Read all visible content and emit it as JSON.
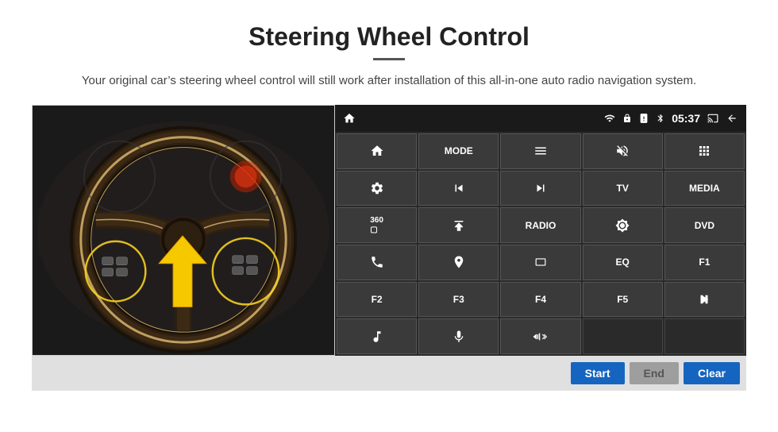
{
  "page": {
    "title": "Steering Wheel Control",
    "subtitle": "Your original car’s steering wheel control will still work after installation of this all-in-one auto radio navigation system.",
    "divider": true
  },
  "status_bar": {
    "time": "05:37",
    "icons": [
      "wifi",
      "lock",
      "sim",
      "bluetooth",
      "battery",
      "cast",
      "back"
    ]
  },
  "button_rows": [
    [
      {
        "label": "⌂",
        "type": "icon",
        "id": "home"
      },
      {
        "label": "MODE",
        "type": "text",
        "id": "mode"
      },
      {
        "label": "≡",
        "type": "icon",
        "id": "menu"
      },
      {
        "label": "🔇",
        "type": "icon",
        "id": "mute"
      },
      {
        "label": "⋯⋯",
        "type": "icon",
        "id": "apps"
      }
    ],
    [
      {
        "label": "⚙",
        "type": "icon",
        "id": "settings"
      },
      {
        "label": "⏮",
        "type": "icon",
        "id": "prev"
      },
      {
        "label": "⏭",
        "type": "icon",
        "id": "next"
      },
      {
        "label": "TV",
        "type": "text",
        "id": "tv"
      },
      {
        "label": "MEDIA",
        "type": "text",
        "id": "media"
      }
    ],
    [
      {
        "label": "360□",
        "type": "icon",
        "id": "camera360"
      },
      {
        "label": "⏶",
        "type": "icon",
        "id": "eject"
      },
      {
        "label": "RADIO",
        "type": "text",
        "id": "radio"
      },
      {
        "label": "☀",
        "type": "icon",
        "id": "brightness"
      },
      {
        "label": "DVD",
        "type": "text",
        "id": "dvd"
      }
    ],
    [
      {
        "label": "☎",
        "type": "icon",
        "id": "phone"
      },
      {
        "label": "⌘",
        "type": "icon",
        "id": "nav"
      },
      {
        "label": "▬",
        "type": "icon",
        "id": "screen"
      },
      {
        "label": "EQ",
        "type": "text",
        "id": "eq"
      },
      {
        "label": "F1",
        "type": "text",
        "id": "f1"
      }
    ],
    [
      {
        "label": "F2",
        "type": "text",
        "id": "f2"
      },
      {
        "label": "F3",
        "type": "text",
        "id": "f3"
      },
      {
        "label": "F4",
        "type": "text",
        "id": "f4"
      },
      {
        "label": "F5",
        "type": "text",
        "id": "f5"
      },
      {
        "label": "▶⏸",
        "type": "icon",
        "id": "playpause"
      }
    ],
    [
      {
        "label": "♫",
        "type": "icon",
        "id": "music"
      },
      {
        "label": "🎤",
        "type": "icon",
        "id": "mic"
      },
      {
        "label": "🔈←→",
        "type": "icon",
        "id": "volphone"
      },
      {
        "label": "",
        "type": "empty",
        "id": "empty1"
      },
      {
        "label": "",
        "type": "empty",
        "id": "empty2"
      }
    ]
  ],
  "action_bar": {
    "start_label": "Start",
    "end_label": "End",
    "clear_label": "Clear"
  }
}
